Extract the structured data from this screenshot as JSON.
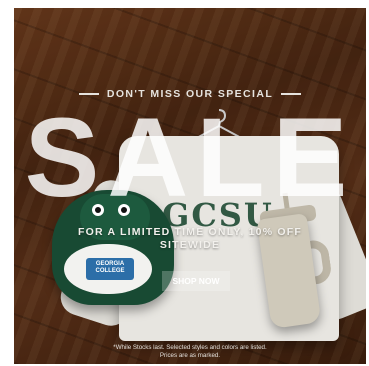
{
  "banner": {
    "eyebrow": "DON'T MISS OUR SPECIAL",
    "headline": "SALE",
    "subheadline": "FOR A LIMITED TIME ONLY, 10% OFF SITEWIDE",
    "cta_label": "SHOP NOW",
    "disclaimer_line1": "*While Stocks last. Selected styles and colors are listed.",
    "disclaimer_line2": "Prices are as marked."
  },
  "products": {
    "sweater_print": "GCSU",
    "plush_logo": "GEORGIA COLLEGE"
  },
  "colors": {
    "text": "#e6e3de",
    "cta_bg": "rgba(255,255,255,0.24)",
    "plush": "#184a33"
  }
}
